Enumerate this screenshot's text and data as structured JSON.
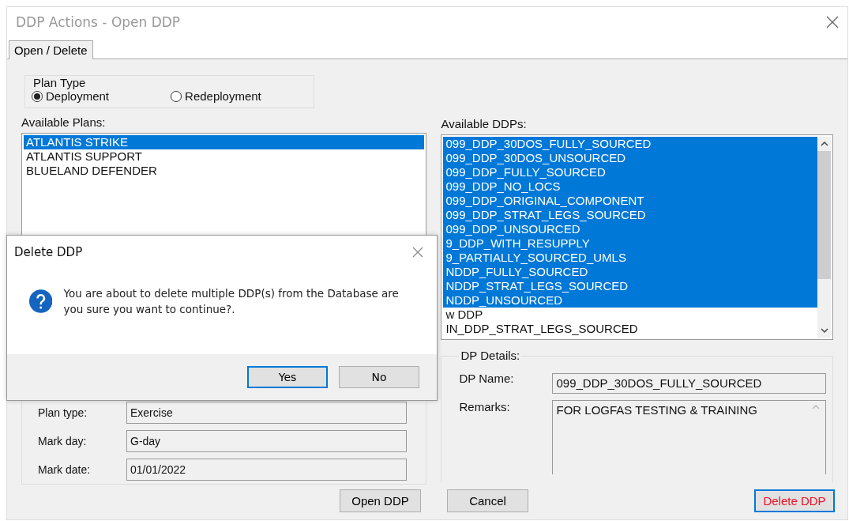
{
  "window": {
    "title": "DDP Actions - Open DDP"
  },
  "tabs": [
    {
      "label": "Open / Delete",
      "selected": true
    }
  ],
  "plan_type": {
    "title": "Plan Type",
    "options": [
      {
        "label": "Deployment",
        "selected": true
      },
      {
        "label": "Redeployment",
        "selected": false
      }
    ]
  },
  "available_plans": {
    "label": "Available Plans:",
    "items": [
      {
        "label": "ATLANTIS STRIKE",
        "selected": true
      },
      {
        "label": "ATLANTIS SUPPORT",
        "selected": false
      },
      {
        "label": "BLUELAND DEFENDER",
        "selected": false
      }
    ]
  },
  "plan_details": {
    "fields": [
      {
        "label": "Plan type:",
        "value": "Exercise"
      },
      {
        "label": "Mark day:",
        "value": "G-day"
      },
      {
        "label": "Mark date:",
        "value": "01/01/2022"
      }
    ]
  },
  "available_ddps": {
    "label": "Available DDPs:",
    "items": [
      {
        "label": "099_DDP_30DOS_FULLY_SOURCED",
        "selected": true
      },
      {
        "label": "099_DDP_30DOS_UNSOURCED",
        "selected": true
      },
      {
        "label": "099_DDP_FULLY_SOURCED",
        "selected": true
      },
      {
        "label": "099_DDP_NO_LOCS",
        "selected": true
      },
      {
        "label": "099_DDP_ORIGINAL_COMPONENT",
        "selected": true
      },
      {
        "label": "099_DDP_STRAT_LEGS_SOURCED",
        "selected": true
      },
      {
        "label": "099_DDP_UNSOURCED",
        "selected": true
      },
      {
        "label": "9_DDP_WITH_RESUPPLY",
        "selected": true
      },
      {
        "label": "9_PARTIALLY_SOURCED_UMLS",
        "selected": true
      },
      {
        "label": "NDDP_FULLY_SOURCED",
        "selected": true
      },
      {
        "label": "NDDP_STRAT_LEGS_SOURCED",
        "selected": true
      },
      {
        "label": "NDDP_UNSOURCED",
        "selected": true
      },
      {
        "label": "w DDP",
        "selected": false
      },
      {
        "label": "IN_DDP_STRAT_LEGS_SOURCED",
        "selected": false
      }
    ]
  },
  "ddp_details": {
    "title": "DP Details:",
    "name_label": "DP Name:",
    "name_value": "099_DDP_30DOS_FULLY_SOURCED",
    "remarks_label": "Remarks:",
    "remarks_value": "FOR LOGFAS TESTING & TRAINING"
  },
  "buttons": [
    {
      "label": "Open DDP",
      "kind": "normal"
    },
    {
      "label": "Cancel",
      "kind": "normal"
    },
    {
      "label": "Delete DDP",
      "kind": "danger"
    }
  ],
  "dialog": {
    "title": "Delete DDP",
    "message": "You are about to delete multiple DDP(s) from the Database are you sure you want to continue?.",
    "buttons": [
      {
        "label": "Yes",
        "focused": true
      },
      {
        "label": "No",
        "focused": false
      }
    ]
  }
}
